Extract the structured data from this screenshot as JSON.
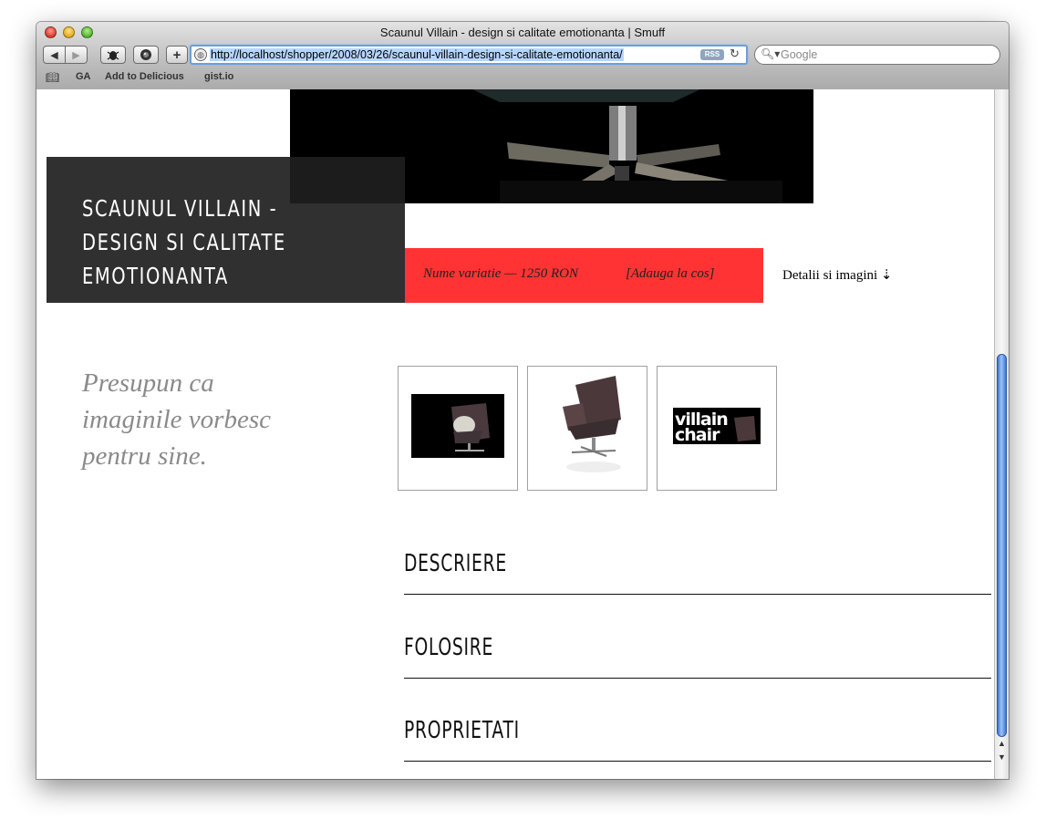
{
  "window": {
    "title": "Scaunul Villain - design si calitate emotionanta | Smuff"
  },
  "toolbar": {
    "back_label": "◀",
    "forward_label": "▶",
    "add_label": "+",
    "url": "http://localhost/shopper/2008/03/26/scaunul-villain-design-si-calitate-emotionanta/",
    "rss_label": "RSS",
    "search_placeholder": "Google"
  },
  "bookmarks": [
    "GA",
    "Add to Delicious",
    "gist.io"
  ],
  "page": {
    "title": "SCAUNUL VILLAIN - DESIGN SI CALITATE EMOTIONANTA",
    "price_text": "Nume variatie — 1250 RON",
    "add_to_cart": "[Adauga la cos]",
    "details_link": "Detalii si imagini ⇣",
    "quote": "Presupun ca imaginile vorbesc pentru sine.",
    "thumbnail_logo_text": "villain chair",
    "sections": [
      "DESCRIERE",
      "FOLOSIRE",
      "PROPRIETATI"
    ]
  },
  "colors": {
    "accent_red": "#ff3333",
    "title_box": "#1e1e1e",
    "url_highlight": "#b5d5ff",
    "scroll_thumb": "#3b74d3"
  }
}
